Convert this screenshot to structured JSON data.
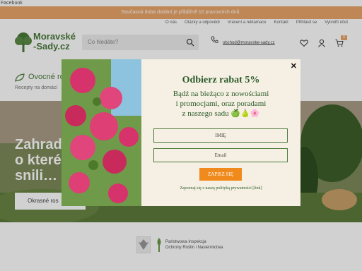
{
  "topbar": {
    "facebook_label": "Facebook"
  },
  "promo": {
    "text": "Současná doba dodání je přibližně 10 pracovních dnů."
  },
  "top_links": [
    "O nás",
    "Otázky a odpovědi",
    "Vrácení a reklamace",
    "Kontakt",
    "Přihlásit se",
    "Vytvořit účet"
  ],
  "logo": {
    "line1": "Moravské",
    "line2": "-Sady.cz"
  },
  "search": {
    "placeholder": "Co hledáte?"
  },
  "contact": {
    "email": "obchod@moravske-sady.cz"
  },
  "cart": {
    "count": "0"
  },
  "nav": {
    "label": "Ovocné ro",
    "sub": "Recepty na domácí"
  },
  "hero": {
    "title_line1": "Zahrada",
    "title_line2": "o které",
    "title_line3": "snili…",
    "button": "Okrasné ros"
  },
  "modal": {
    "title": "Odbierz rabat 5%",
    "text_line1": "Bądź na bieżąco z nowościami",
    "text_line2": "i promocjami, oraz poradami",
    "text_line3": "z naszego sadu 🍏🍐🌸",
    "name_placeholder": "IMIĘ",
    "email_placeholder": "Email",
    "submit": "ZAPISZ SIĘ",
    "privacy": "Zapoznaj się z naszą polityką prywatności [link]",
    "close": "✕"
  },
  "footer": {
    "line1": "Państwowa Inspekcja",
    "line2": "Ochrony Roślin i Nasiennictwa"
  },
  "colors": {
    "accent": "#e9a56a",
    "brand_green": "#4a7a3a",
    "submit": "#f08a1c",
    "modal_bg": "#f5f0e3"
  }
}
